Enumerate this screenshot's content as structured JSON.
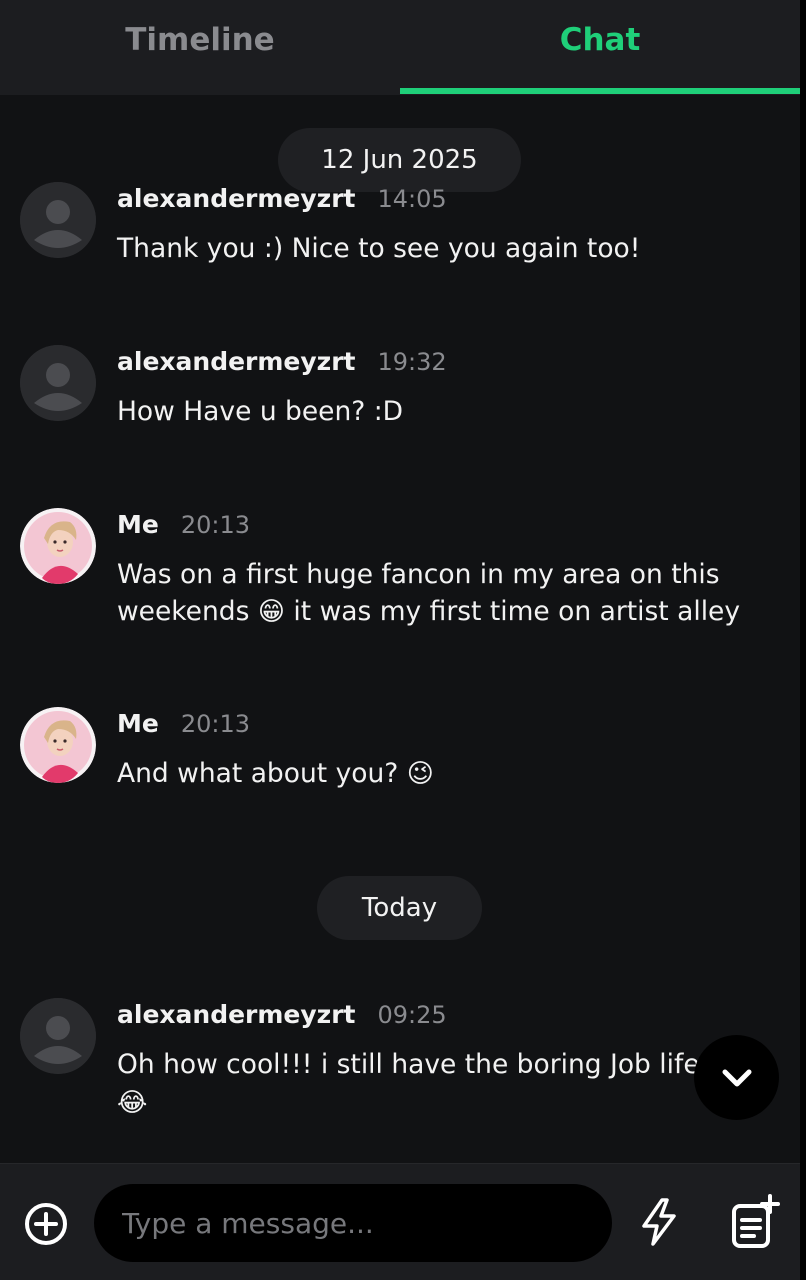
{
  "tabs": [
    {
      "label": "Timeline",
      "active": false
    },
    {
      "label": "Chat",
      "active": true
    }
  ],
  "colors": {
    "accent": "#1fcf79",
    "background": "#111214",
    "panel": "#1c1d20"
  },
  "date_separators": [
    "12 Jun 2025",
    "Today"
  ],
  "messages": [
    {
      "author": "alexandermeyzrt",
      "time": "14:05",
      "text": "Thank you :) Nice to see you again too!",
      "avatar": "default-avatar-icon"
    },
    {
      "author": "alexandermeyzrt",
      "time": "19:32",
      "text": "How Have u been? :D",
      "avatar": "default-avatar-icon"
    },
    {
      "author": "Me",
      "time": "20:13",
      "text": "Was on a first huge fancon in my area on this weekends",
      "emoji": "😁",
      "text_after": "it was my first time on artist alley",
      "avatar": "user-avatar"
    },
    {
      "author": "Me",
      "time": "20:13",
      "text": "And what about you?",
      "emoji": "😉",
      "avatar": "user-avatar"
    },
    {
      "author": "alexandermeyzrt",
      "time": "09:25",
      "text": "Oh how cool!!! i still have the boring Job life",
      "emoji": "😅",
      "emoji2": "😂",
      "avatar": "default-avatar-icon"
    }
  ],
  "composer": {
    "placeholder": "Type a message...",
    "add_icon": "plus-circle-icon",
    "quick_icon": "lightning-icon",
    "note_icon": "note-add-icon"
  },
  "scroll_button_icon": "chevron-down-icon"
}
